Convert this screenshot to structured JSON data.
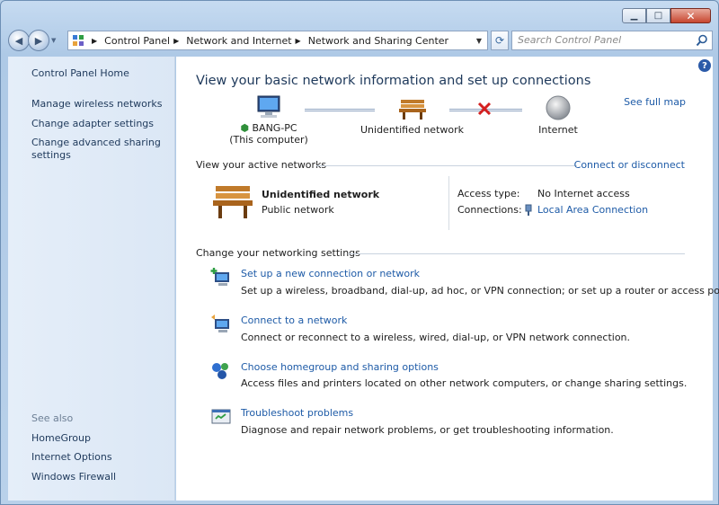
{
  "window": {
    "minimize": "▁",
    "maximize": "□",
    "close": "✕"
  },
  "address": {
    "crumbs": [
      "Control Panel",
      "Network and Internet",
      "Network and Sharing Center"
    ],
    "search_placeholder": "Search Control Panel"
  },
  "sidebar": {
    "home": "Control Panel Home",
    "items": [
      "Manage wireless networks",
      "Change adapter settings",
      "Change advanced sharing settings"
    ],
    "see_also_label": "See also",
    "see_also": [
      "HomeGroup",
      "Internet Options",
      "Windows Firewall"
    ]
  },
  "main": {
    "heading": "View your basic network information and set up connections",
    "see_full_map": "See full map",
    "map": {
      "computer_name": "BANG-PC",
      "computer_sub": "(This computer)",
      "network": "Unidentified network",
      "internet": "Internet"
    },
    "active": {
      "title": "View your active networks",
      "connect_link": "Connect or disconnect",
      "network_name": "Unidentified network",
      "network_type": "Public network",
      "access_type_label": "Access type:",
      "access_type_value": "No Internet access",
      "connections_label": "Connections:",
      "connections_value": "Local Area Connection"
    },
    "settings": {
      "title": "Change your networking settings",
      "tasks": [
        {
          "link": "Set up a new connection or network",
          "desc": "Set up a wireless, broadband, dial-up, ad hoc, or VPN connection; or set up a router or access point."
        },
        {
          "link": "Connect to a network",
          "desc": "Connect or reconnect to a wireless, wired, dial-up, or VPN network connection."
        },
        {
          "link": "Choose homegroup and sharing options",
          "desc": "Access files and printers located on other network computers, or change sharing settings."
        },
        {
          "link": "Troubleshoot problems",
          "desc": "Diagnose and repair network problems, or get troubleshooting information."
        }
      ]
    }
  },
  "colors": {
    "link": "#1e5ba7",
    "heading": "#1e395b",
    "error": "#d42020"
  }
}
